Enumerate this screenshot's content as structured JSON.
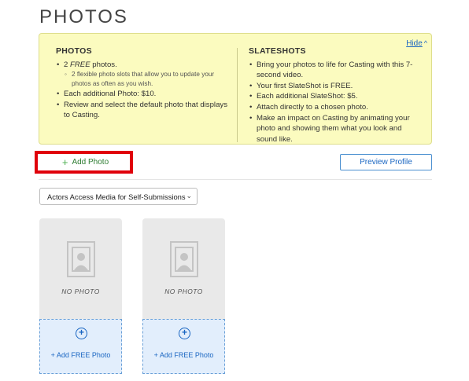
{
  "page": {
    "title": "PHOTOS"
  },
  "info": {
    "hide_label": "Hide",
    "hide_icon": "chevron-up-icon",
    "photos": {
      "heading": "PHOTOS",
      "items": [
        {
          "pre": "2 ",
          "em": "FREE",
          "post": " photos."
        },
        {
          "sub": "2 flexible photo slots that allow you to update your photos as often as you wish."
        },
        {
          "text": "Each additional Photo: $10."
        },
        {
          "text": "Review and select the default photo that displays to Casting."
        }
      ]
    },
    "slateshots": {
      "heading": "SLATESHOTS",
      "items": [
        "Bring your photos to life for Casting with this 7-second video.",
        "Your first SlateShot is FREE.",
        "Each additional SlateShot: $5.",
        "Attach directly to a chosen photo.",
        "Make an impact on Casting by animating your photo and showing them what you look and sound like."
      ]
    }
  },
  "toolbar": {
    "add_photo_icon": "plus-icon",
    "add_photo_label": "Add Photo",
    "preview_label": "Preview Profile",
    "highlight_color": "#e0000b"
  },
  "media_select": {
    "selected": "Actors Access Media for Self-Submissions",
    "icon": "chevron-down-icon"
  },
  "slots": [
    {
      "placeholder": "NO PHOTO",
      "add_label": "+ Add FREE Photo"
    },
    {
      "placeholder": "NO PHOTO",
      "add_label": "+ Add FREE Photo"
    }
  ]
}
